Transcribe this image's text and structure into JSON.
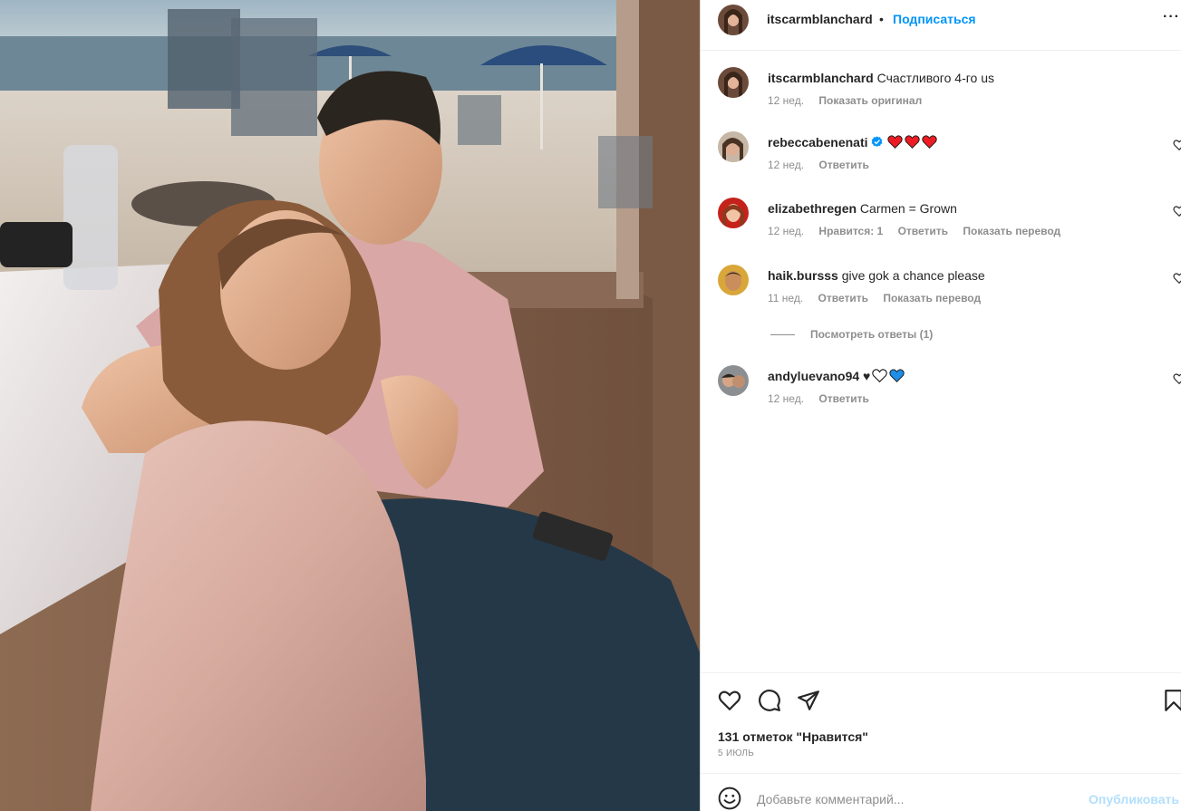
{
  "post": {
    "author": "itscarmblanchard",
    "separator": "•",
    "follow_label": "Подписаться",
    "more_icon": "more-options-icon",
    "more_glyph": "···"
  },
  "caption": {
    "username": "itscarmblanchard",
    "text": "Счастливого 4-го us",
    "time": "12 нед.",
    "action": "Показать оригинал"
  },
  "comments": [
    {
      "username": "rebeccabenenati",
      "verified": true,
      "text": "",
      "emoji": [
        "red-heart",
        "red-heart",
        "red-heart"
      ],
      "time": "12 нед.",
      "actions": [
        "Ответить"
      ]
    },
    {
      "username": "elizabethregen",
      "text": "Carmen = Grown",
      "time": "12 нед.",
      "actions": [
        "Нравится: 1",
        "Ответить",
        "Показать перевод"
      ]
    },
    {
      "username": "haik.bursss",
      "text": "give gok a chance please",
      "time": "11 нед.",
      "actions": [
        "Ответить",
        "Показать перевод"
      ]
    },
    {
      "username": "andyluevano94",
      "text": "♥",
      "emoji": [
        "white-heart",
        "blue-heart"
      ],
      "time": "12 нед.",
      "actions": [
        "Ответить"
      ]
    }
  ],
  "view_replies": "Посмотреть ответы (1)",
  "likes": "131 отметок \"Нравится\"",
  "date": "5 ИЮЛЬ",
  "add_comment": {
    "placeholder": "Добавьте комментарий...",
    "publish_label": "Опубликовать"
  },
  "colors": {
    "link_blue": "#0095f6",
    "publish_disabled": "#b2dffc",
    "secondary_text": "#8e8e8e",
    "verified_blue": "#0095f6",
    "heart_red": "#ed1c24"
  }
}
